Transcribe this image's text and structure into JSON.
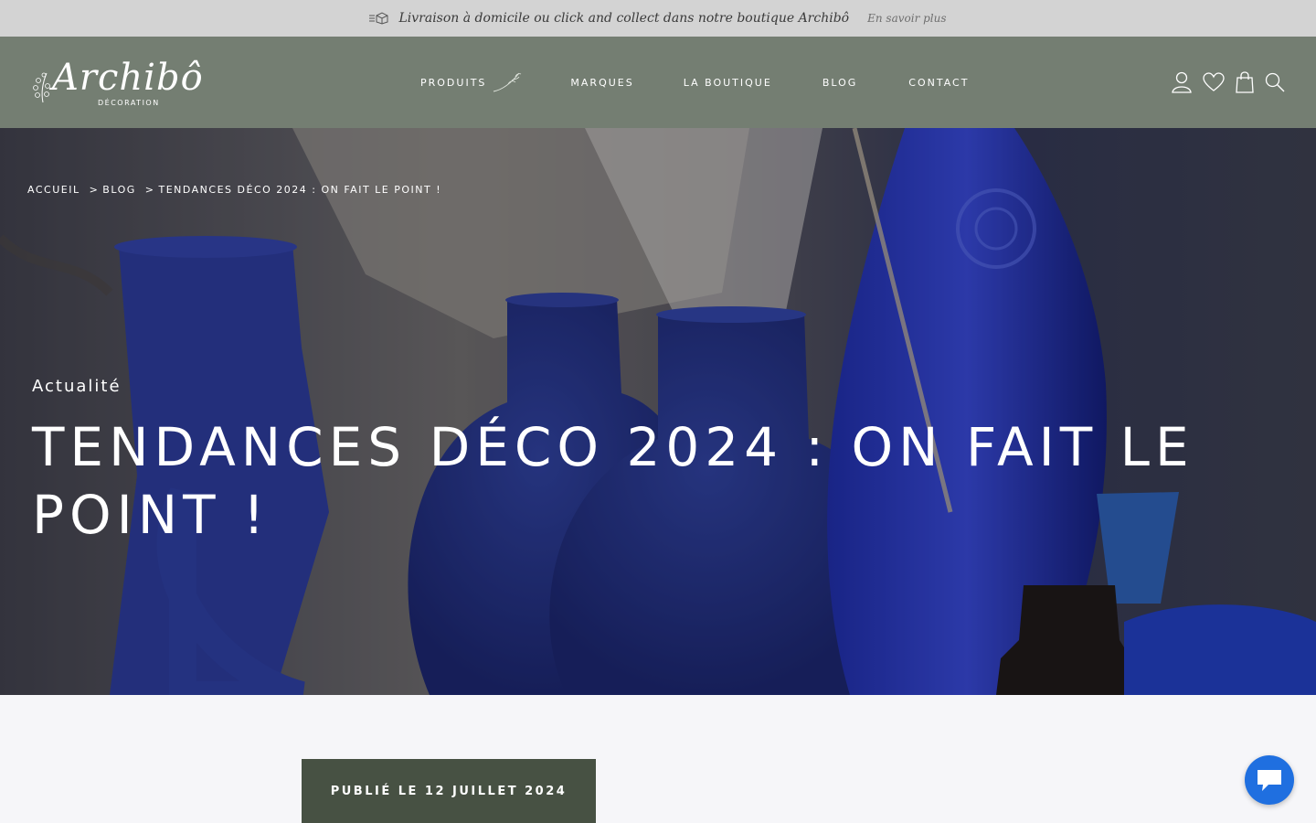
{
  "announcement": {
    "message": "Livraison à domicile ou click and collect dans notre boutique Archibô",
    "link": "En savoir plus"
  },
  "header": {
    "logo_text": "Archibô",
    "logo_subtitle": "DÉCORATION",
    "nav": [
      "PRODUITS",
      "MARQUES",
      "LA BOUTIQUE",
      "BLOG",
      "CONTACT"
    ],
    "icons": [
      "user-icon",
      "heart-icon",
      "bag-icon",
      "search-icon"
    ]
  },
  "hero": {
    "breadcrumb": [
      "ACCUEIL",
      "BLOG",
      "TENDANCES DÉCO 2024 : ON FAIT LE POINT !"
    ],
    "breadcrumb_sep": ">",
    "category": "Actualité",
    "title": "TENDANCES DÉCO 2024 : ON FAIT LE POINT !"
  },
  "article": {
    "published": "PUBLIÉ LE 12 JUILLET 2024"
  },
  "colors": {
    "topbar": "#d3d3d3",
    "header": "#747e72",
    "published_bg": "#475143",
    "chat": "#1f6fe0"
  }
}
